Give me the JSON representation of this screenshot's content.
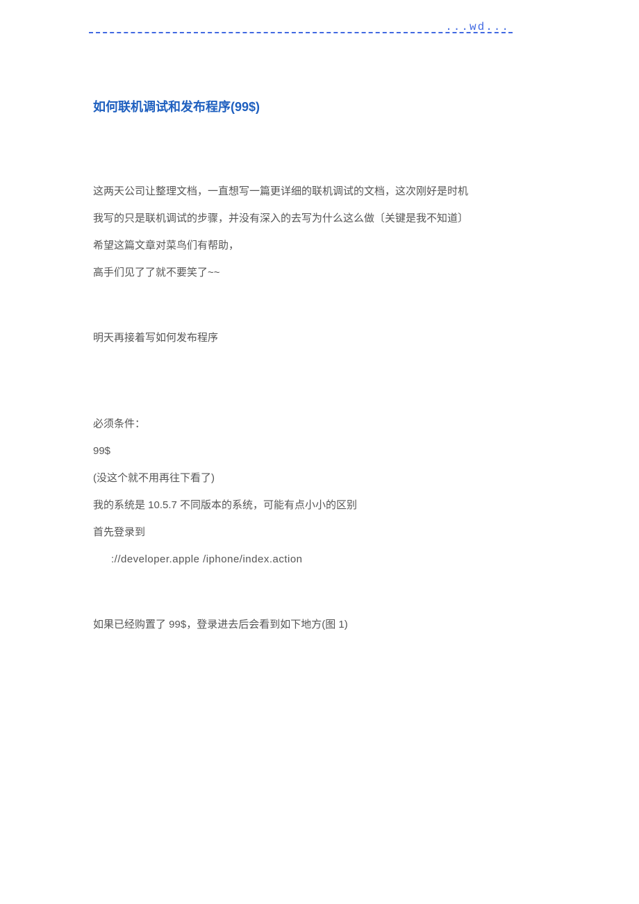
{
  "header": {
    "wd": "...wd..."
  },
  "title": "如何联机调试和发布程序(99$)",
  "paragraphs": {
    "p1": "这两天公司让整理文档，一直想写一篇更详细的联机调试的文档，这次刚好是时机",
    "p2": "我写的只是联机调试的步骤，并没有深入的去写为什么这么做〔关键是我不知道〕",
    "p3": "希望这篇文章对菜鸟们有帮助，",
    "p4": "高手们见了了就不要笑了~~",
    "p5": "明天再接着写如何发布程序",
    "p6": "必须条件：",
    "p7": "99$",
    "p8": "(没这个就不用再往下看了)",
    "p9": "我的系统是 10.5.7    不同版本的系统，可能有点小小的区别",
    "p10": "首先登录到",
    "p11": "://developer.apple      /iphone/index.action",
    "p12": "如果已经购置了 99$，登录进去后会看到如下地方(图 1)"
  }
}
